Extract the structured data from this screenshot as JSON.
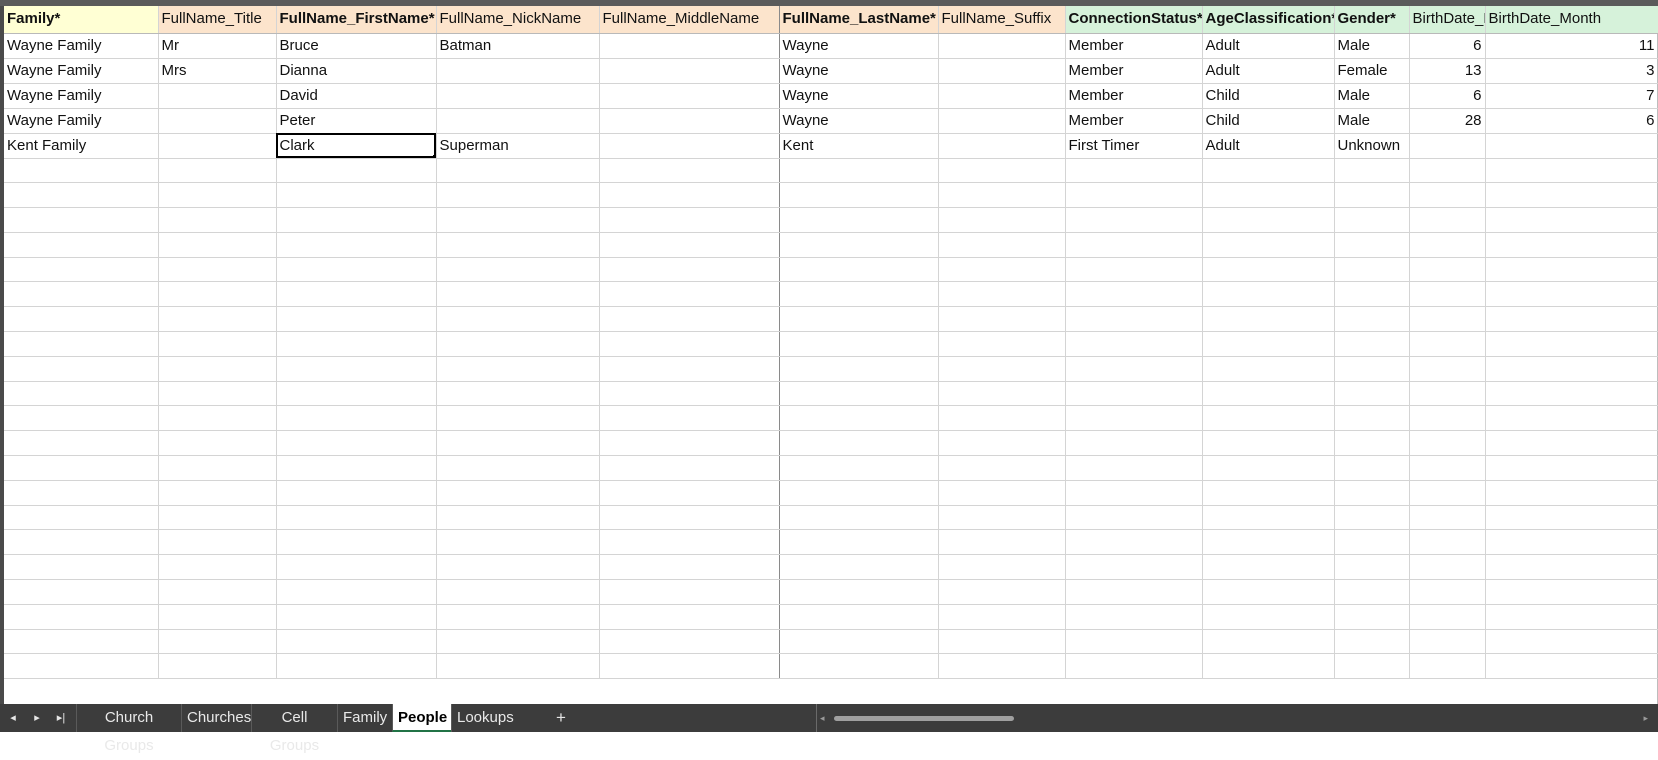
{
  "columns": [
    {
      "label": "Family*"
    },
    {
      "label": "FullName_Title"
    },
    {
      "label": "FullName_FirstName*"
    },
    {
      "label": "FullName_NickName"
    },
    {
      "label": "FullName_MiddleName"
    },
    {
      "label": "FullName_LastName*"
    },
    {
      "label": "FullName_Suffix"
    },
    {
      "label": "ConnectionStatus*"
    },
    {
      "label": "AgeClassification*"
    },
    {
      "label": "Gender*"
    },
    {
      "label": "BirthDate_Day"
    },
    {
      "label": "BirthDate_Month"
    }
  ],
  "rows": [
    [
      "Wayne Family",
      "Mr",
      "Bruce",
      "Batman",
      "",
      "Wayne",
      "",
      "Member",
      "Adult",
      "Male",
      "6",
      "11"
    ],
    [
      "Wayne Family",
      "Mrs",
      "Dianna",
      "",
      "",
      "Wayne",
      "",
      "Member",
      "Adult",
      "Female",
      "13",
      "3"
    ],
    [
      "Wayne Family",
      "",
      "David",
      "",
      "",
      "Wayne",
      "",
      "Member",
      "Child",
      "Male",
      "6",
      "7"
    ],
    [
      "Wayne Family",
      "",
      "Peter",
      "",
      "",
      "Wayne",
      "",
      "Member",
      "Child",
      "Male",
      "28",
      "6"
    ],
    [
      "Kent Family",
      "",
      "Clark",
      "Superman",
      "",
      "Kent",
      "",
      "First Timer",
      "Adult",
      "Unknown",
      "",
      ""
    ]
  ],
  "selected_cell": "FullName_FirstName row 5",
  "sheet_tabs": [
    {
      "label": "Church Groups",
      "active": false
    },
    {
      "label": "Churches",
      "active": false
    },
    {
      "label": "Cell Groups",
      "active": false
    },
    {
      "label": "Family",
      "active": false
    },
    {
      "label": "People",
      "active": true
    },
    {
      "label": "Lookups",
      "active": false
    }
  ],
  "nav": {
    "prev_icon": "◂",
    "next_icon": "▸",
    "last_icon": "▸|",
    "add_tab": "+"
  },
  "colors": {
    "header_required": "#ffffd4",
    "header_name": "#fce4cc",
    "header_status": "#d6f2da",
    "tabbar": "#3c3c3c"
  }
}
